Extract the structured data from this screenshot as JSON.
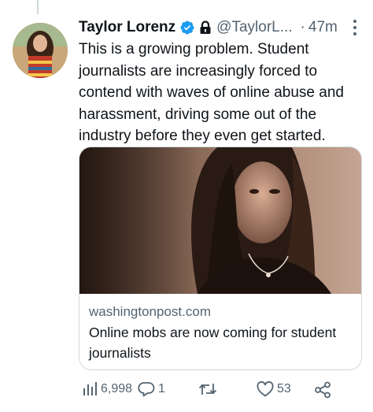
{
  "tweet": {
    "author": {
      "display_name": "Taylor Lorenz",
      "handle": "@TaylorL...",
      "verified": true,
      "protected": true
    },
    "separator": "·",
    "timestamp": "47m",
    "text": "This is a growing problem. Student journalists are increasingly forced to contend with waves of online abuse and harassment, driving some out of the industry before they even get started.",
    "card": {
      "domain": "washingtonpost.com",
      "title": "Online mobs are now coming for student journalists"
    },
    "actions": {
      "views": "6,998",
      "replies": "1",
      "retweets": "",
      "likes": "53"
    }
  },
  "colors": {
    "text_primary": "#0f1419",
    "text_secondary": "#536471",
    "verified_blue": "#1d9bf0",
    "border": "#cfd9de"
  },
  "icons": {
    "verified": "verified-badge-icon",
    "lock": "lock-icon",
    "more": "more-vertical-icon",
    "views": "analytics-icon",
    "reply": "reply-icon",
    "retweet": "retweet-icon",
    "like": "heart-icon",
    "share": "share-icon"
  }
}
